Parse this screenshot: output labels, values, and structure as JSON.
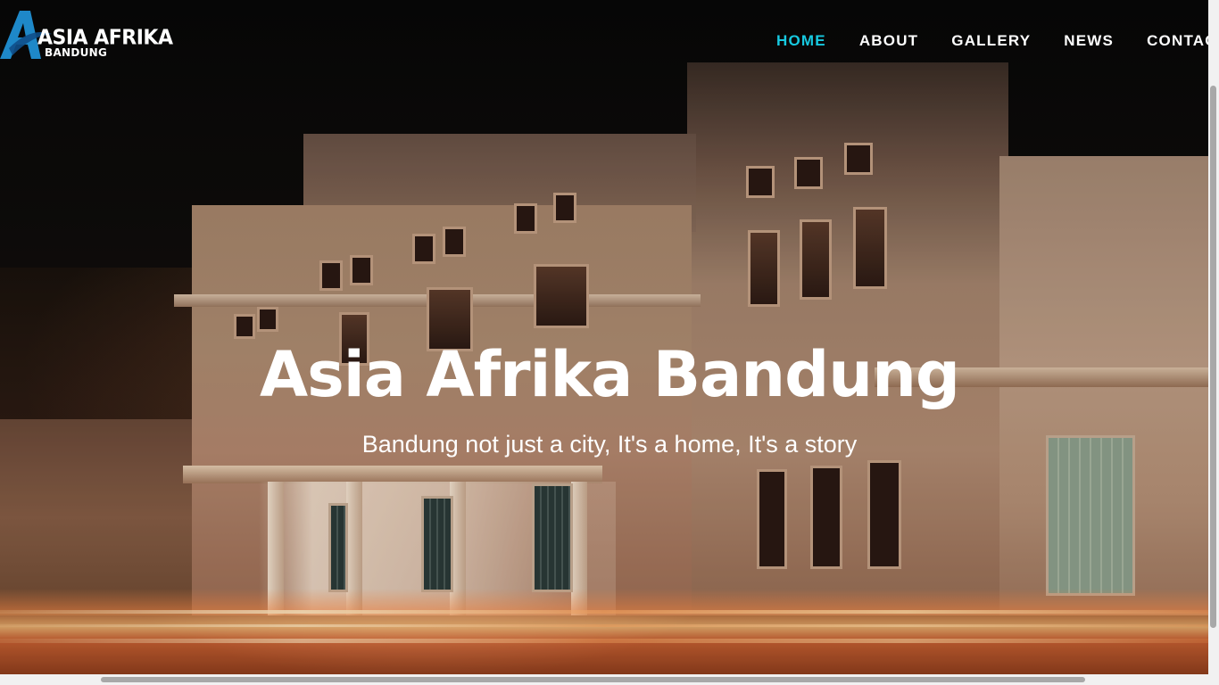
{
  "site": {
    "logo": {
      "title": "ASIA AFRIKA",
      "subtitle": "BANDUNG",
      "icon": "logo-a-mark",
      "mark_color": "#1e88c8"
    },
    "nav": {
      "items": [
        {
          "label": "HOME",
          "active": true
        },
        {
          "label": "ABOUT",
          "active": false
        },
        {
          "label": "GALLERY",
          "active": false
        },
        {
          "label": "NEWS",
          "active": false
        },
        {
          "label": "CONTAC",
          "active": false
        }
      ],
      "active_color": "#17c9e0",
      "text_color": "#ffffff"
    }
  },
  "hero": {
    "title": "Asia Afrika Bandung",
    "subtitle": "Bandung not just a city, It's a home, It's a story",
    "background": "night-photo-of-gedung-merdeka-building-with-light-trails"
  },
  "scrollbars": {
    "vertical": true,
    "horizontal": true
  }
}
